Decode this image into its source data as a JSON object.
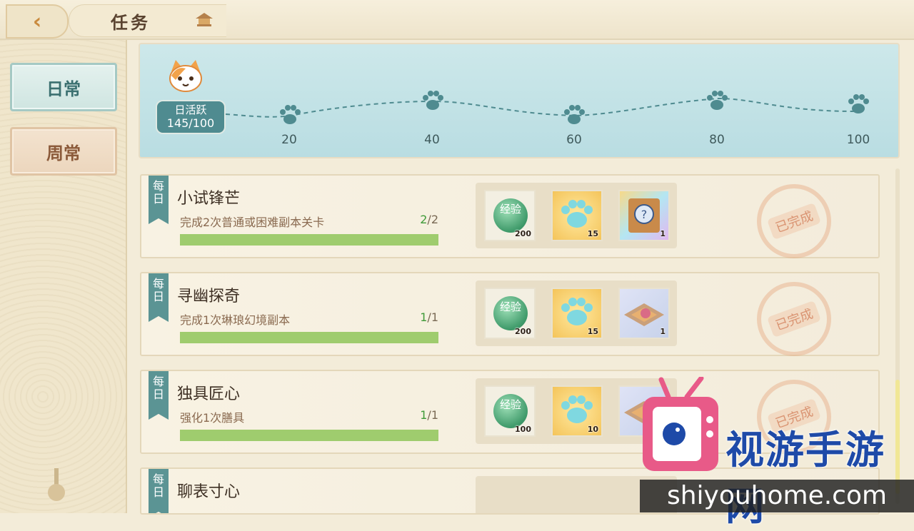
{
  "header": {
    "title": "任务"
  },
  "tabs": {
    "daily": "日常",
    "weekly": "周常"
  },
  "activity": {
    "label": "日活跃",
    "value": "145/100",
    "milestones": [
      "20",
      "40",
      "60",
      "80",
      "100"
    ]
  },
  "tasks": [
    {
      "tag": "每日",
      "name": "小试锋芒",
      "desc": "完成2次普通或困难副本关卡",
      "done": "2",
      "total": "/2",
      "progress": 1.0,
      "rewards": [
        {
          "label": "经验",
          "qty": "200"
        },
        {
          "qty": "15"
        },
        {
          "qty": "1"
        }
      ],
      "status": "已完成"
    },
    {
      "tag": "每日",
      "name": "寻幽探奇",
      "desc": "完成1次琳琅幻境副本",
      "done": "1",
      "total": "/1",
      "progress": 1.0,
      "rewards": [
        {
          "label": "经验",
          "qty": "200"
        },
        {
          "qty": "15"
        },
        {
          "qty": "1"
        }
      ],
      "status": "已完成"
    },
    {
      "tag": "每日",
      "name": "独具匠心",
      "desc": "强化1次膳具",
      "done": "1",
      "total": "/1",
      "progress": 1.0,
      "rewards": [
        {
          "label": "经验",
          "qty": "100"
        },
        {
          "qty": "10"
        },
        {
          "qty": ""
        }
      ],
      "status": "已完成"
    },
    {
      "tag": "每日",
      "name": "聊表寸心"
    }
  ],
  "watermark": {
    "name": "视游手游网",
    "url": "shiyouhome.com"
  },
  "colors": {
    "accent_teal": "#5b9494",
    "progress_green": "#9fcc6e",
    "watermark_pink": "#e85a88"
  }
}
